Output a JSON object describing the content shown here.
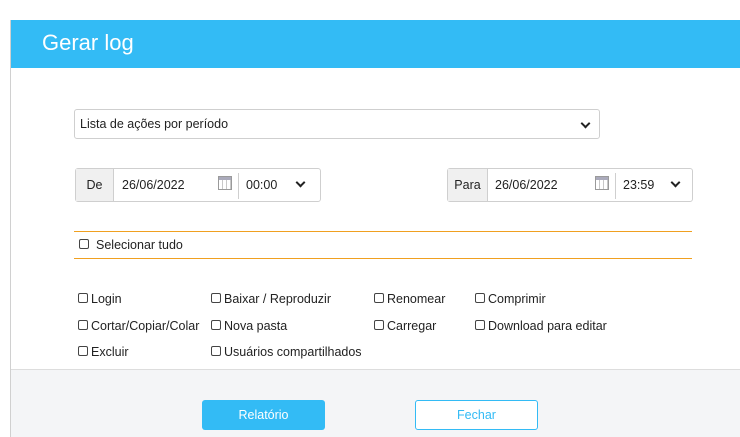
{
  "dialog": {
    "title": "Gerar log",
    "report_type": "Lista de ações por período",
    "from": {
      "label": "De",
      "date": "26/06/2022",
      "time": "00:00"
    },
    "to": {
      "label": "Para",
      "date": "26/06/2022",
      "time": "23:59"
    },
    "select_all": "Selecionar tudo",
    "actions": {
      "login": "Login",
      "download_play": "Baixar / Reproduzir",
      "rename": "Renomear",
      "compress": "Comprimir",
      "cut_copy_paste": "Cortar/Copiar/Colar",
      "new_folder": "Nova pasta",
      "upload": "Carregar",
      "download_edit": "Download para editar",
      "delete": "Excluir",
      "shared_users": "Usuários compartilhados"
    },
    "buttons": {
      "report": "Relatório",
      "close": "Fechar"
    }
  }
}
